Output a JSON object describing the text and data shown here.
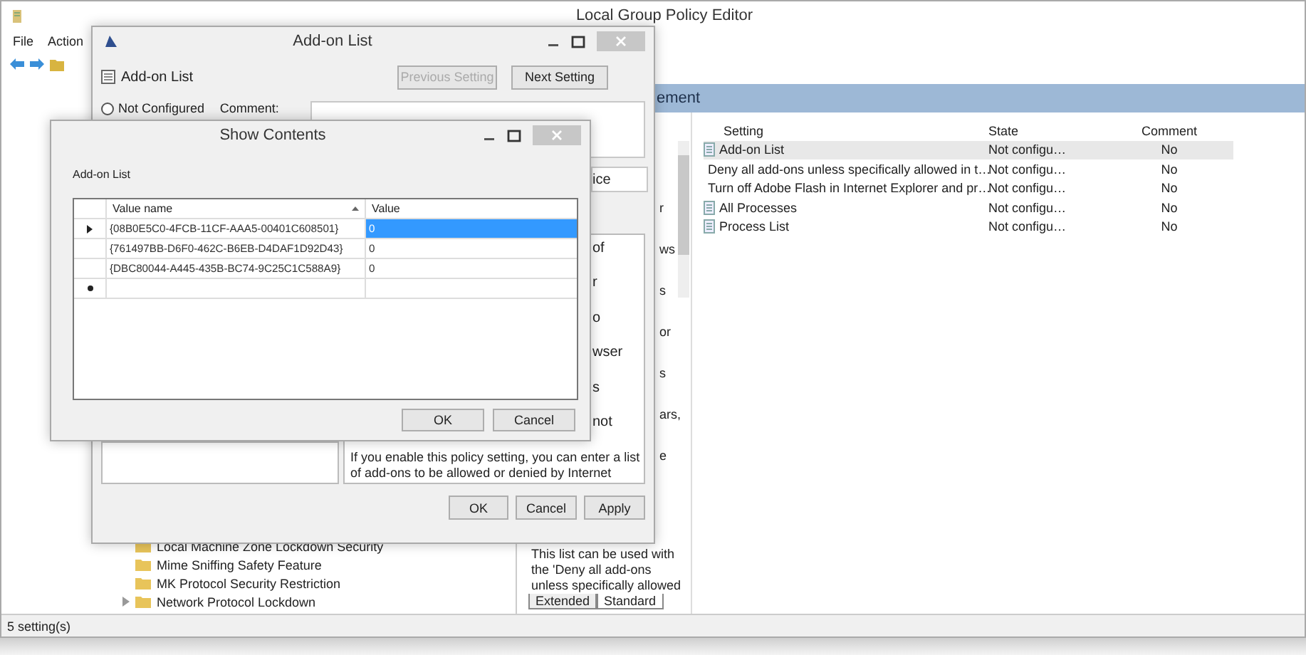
{
  "main_window": {
    "title": "Local Group Policy Editor",
    "menu": [
      "File",
      "Action"
    ],
    "status": "5 setting(s)"
  },
  "tree": {
    "items": [
      {
        "label": "Local Machine Zone Lockdown Security",
        "expandable": false
      },
      {
        "label": "Mime Sniffing Safety Feature",
        "expandable": false
      },
      {
        "label": "MK Protocol Security Restriction",
        "expandable": false
      },
      {
        "label": "Network Protocol Lockdown",
        "expandable": true
      }
    ]
  },
  "header": {
    "title": "ement"
  },
  "description": {
    "fragments": [
      "r",
      "ws",
      "s",
      "or",
      "s",
      "ars,",
      "e"
    ],
    "lines": [
      "This list can be used with",
      "the 'Deny all add-ons",
      "unless specifically allowed"
    ],
    "tabs": [
      {
        "label": "Extended",
        "selected": false
      },
      {
        "label": "Standard",
        "selected": true
      }
    ]
  },
  "list": {
    "columns": [
      "Setting",
      "State",
      "Comment"
    ],
    "rows": [
      {
        "setting": "Add-on List",
        "state": "Not configu…",
        "comment": "No",
        "selected": true
      },
      {
        "setting": "Deny all add-ons unless specifically allowed in t…",
        "state": "Not configu…",
        "comment": "No",
        "selected": false
      },
      {
        "setting": "Turn off Adobe Flash in Internet Explorer and pr…",
        "state": "Not configu…",
        "comment": "No",
        "selected": false
      },
      {
        "setting": "All Processes",
        "state": "Not configu…",
        "comment": "No",
        "selected": false
      },
      {
        "setting": "Process List",
        "state": "Not configu…",
        "comment": "No",
        "selected": false
      }
    ]
  },
  "addon_dialog": {
    "title": "Add-on List",
    "setting_name": "Add-on List",
    "nav_buttons": [
      {
        "label": "Previous Setting",
        "disabled": true
      },
      {
        "label": "Next Setting",
        "disabled": false
      }
    ],
    "radio": {
      "label": "Not Configured",
      "selected": false
    },
    "comment_label": "Comment:",
    "supported_fragment": "ice",
    "help_fragments": [
      "of",
      "r",
      "o",
      "wser",
      "s",
      "not"
    ],
    "help_lines": [
      "If you enable this policy setting, you can enter a list",
      "of add-ons to be allowed or denied by Internet"
    ],
    "buttons": [
      "OK",
      "Cancel",
      "Apply"
    ]
  },
  "show_contents": {
    "title": "Show Contents",
    "label": "Add-on List",
    "columns": [
      "Value name",
      "Value"
    ],
    "rows": [
      {
        "name": "{08B0E5C0-4FCB-11CF-AAA5-00401C608501}",
        "value": "0",
        "selected": true
      },
      {
        "name": "{761497BB-D6F0-462C-B6EB-D4DAF1D92D43}",
        "value": "0",
        "selected": false
      },
      {
        "name": "{DBC80044-A445-435B-BC74-9C25C1C588A9}",
        "value": "0",
        "selected": false
      }
    ],
    "buttons": [
      "OK",
      "Cancel"
    ]
  }
}
